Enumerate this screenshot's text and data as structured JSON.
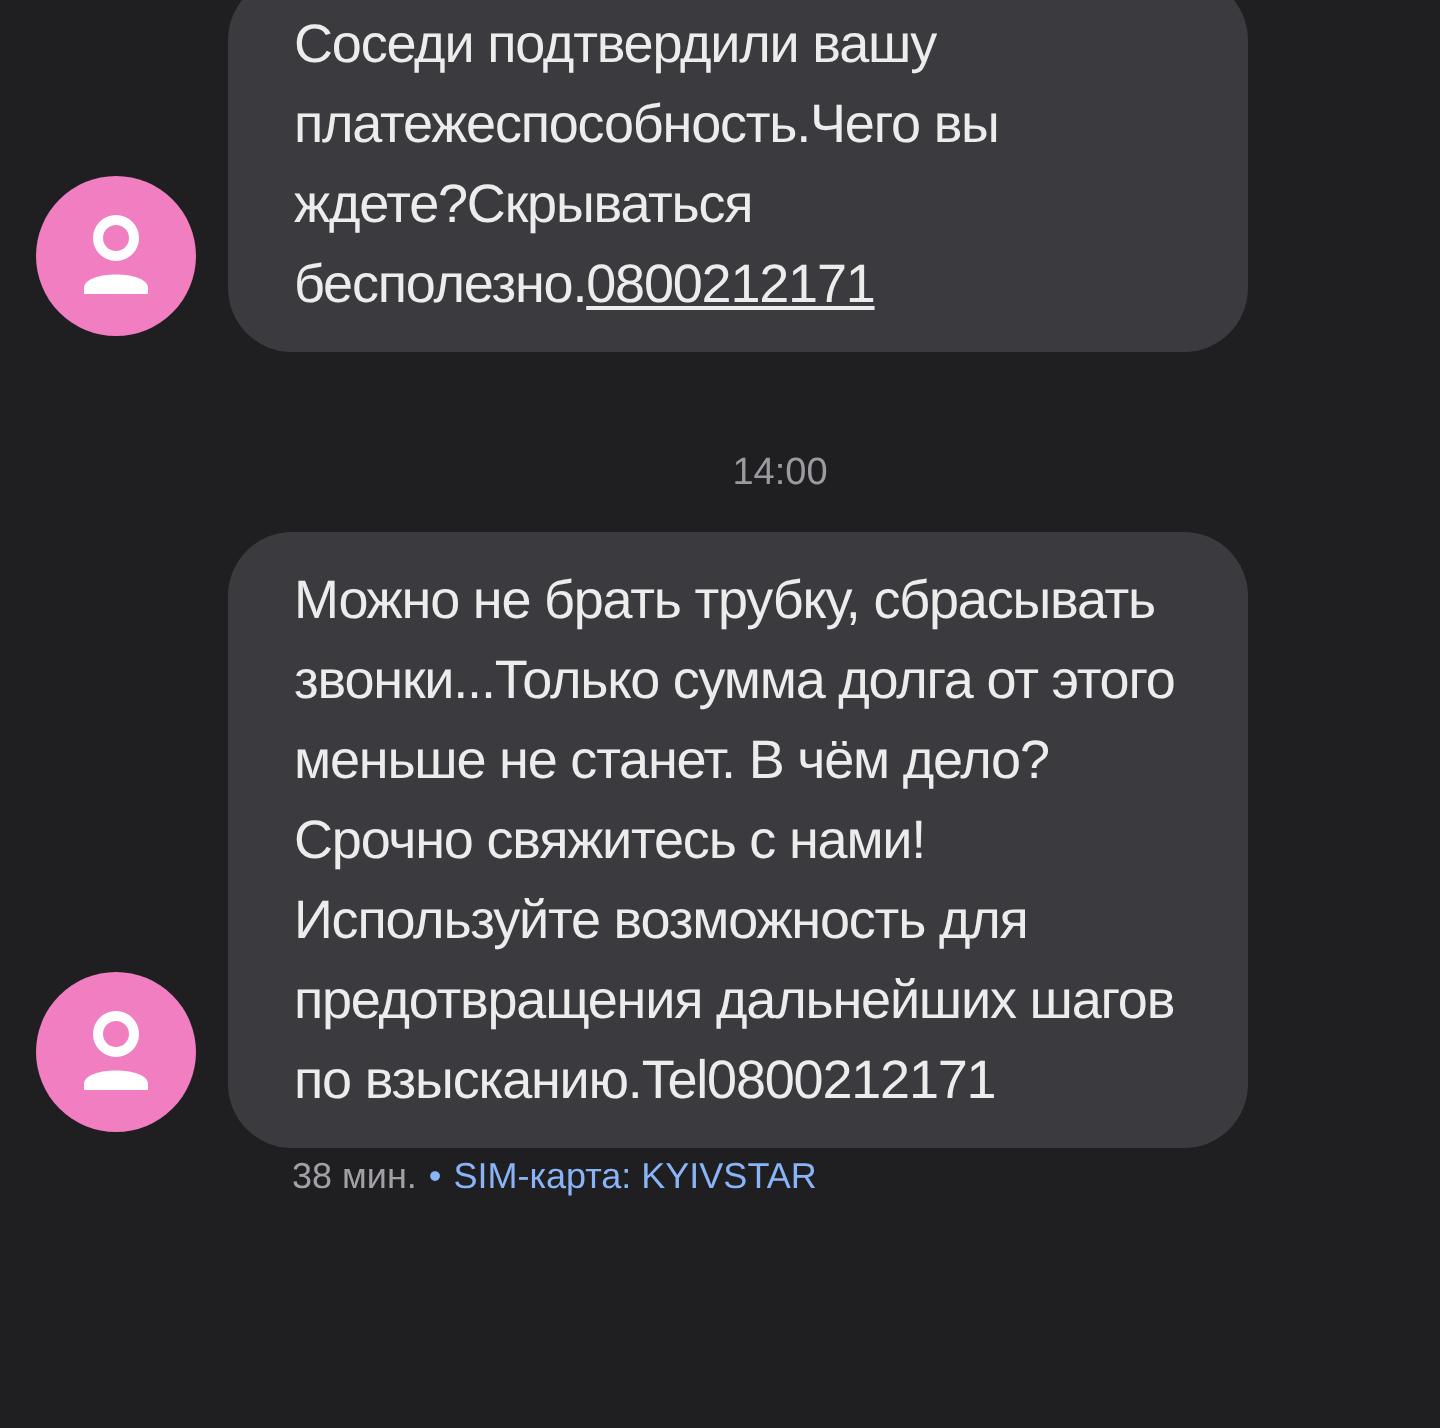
{
  "messages": [
    {
      "text": "Соседи подтвердили вашу платежеспособность.Чего вы ждете?Скрываться бесполезно.",
      "link": "0800212171"
    },
    {
      "text": "Можно не брать трубку, сбрасывать звонки...Только сумма долга от этого меньше не станет. В чём дело? Срочно свяжитесь с нами! Используйте возможность для предотвращения дальнейших шагов по взысканию.Tel0800212171"
    }
  ],
  "timestamp": "14:00",
  "footer": {
    "time": "38 мин.",
    "separator": "•",
    "sim": "SIM-карта: KYIVSTAR"
  }
}
